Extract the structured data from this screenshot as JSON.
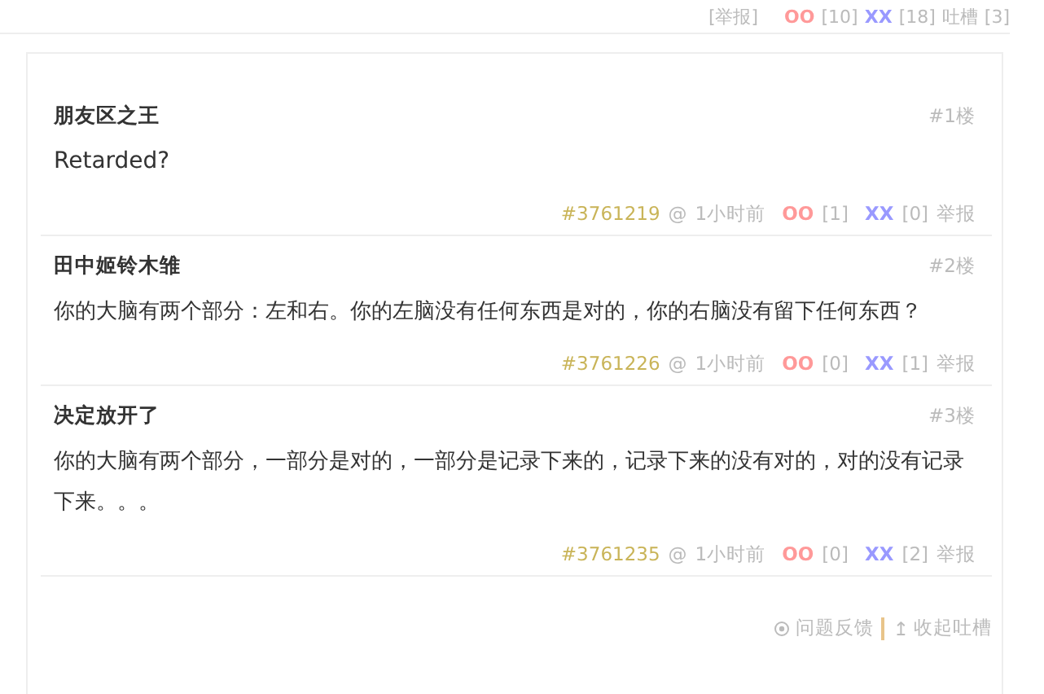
{
  "top_bar": {
    "report": "[举报]",
    "oo_label": "OO",
    "oo_count": "[10]",
    "xx_label": "XX",
    "xx_count": "[18]",
    "tucao_label": "吐槽",
    "tucao_count": "[3]"
  },
  "comments": [
    {
      "author": "朋友区之王",
      "floor": "#1楼",
      "text": "Retarded?",
      "id": "#3761219",
      "at": "@",
      "time": "1小时前",
      "oo_label": "OO",
      "oo_count": "[1]",
      "xx_label": "XX",
      "xx_count": "[0]",
      "report": "举报"
    },
    {
      "author": "田中姬铃木雏",
      "floor": "#2楼",
      "text": "你的大脑有两个部分：左和右。你的左脑没有任何东西是对的，你的右脑没有留下任何东西？",
      "id": "#3761226",
      "at": "@",
      "time": "1小时前",
      "oo_label": "OO",
      "oo_count": "[0]",
      "xx_label": "XX",
      "xx_count": "[1]",
      "report": "举报"
    },
    {
      "author": "决定放开了",
      "floor": "#3楼",
      "text": "你的大脑有两个部分，一部分是对的，一部分是记录下来的，记录下来的没有对的，对的没有记录下来。。。",
      "id": "#3761235",
      "at": "@",
      "time": "1小时前",
      "oo_label": "OO",
      "oo_count": "[0]",
      "xx_label": "XX",
      "xx_count": "[2]",
      "report": "举报"
    }
  ],
  "footer": {
    "feedback": "问题反馈",
    "collapse_icon": "↥",
    "collapse": "收起吐槽"
  }
}
